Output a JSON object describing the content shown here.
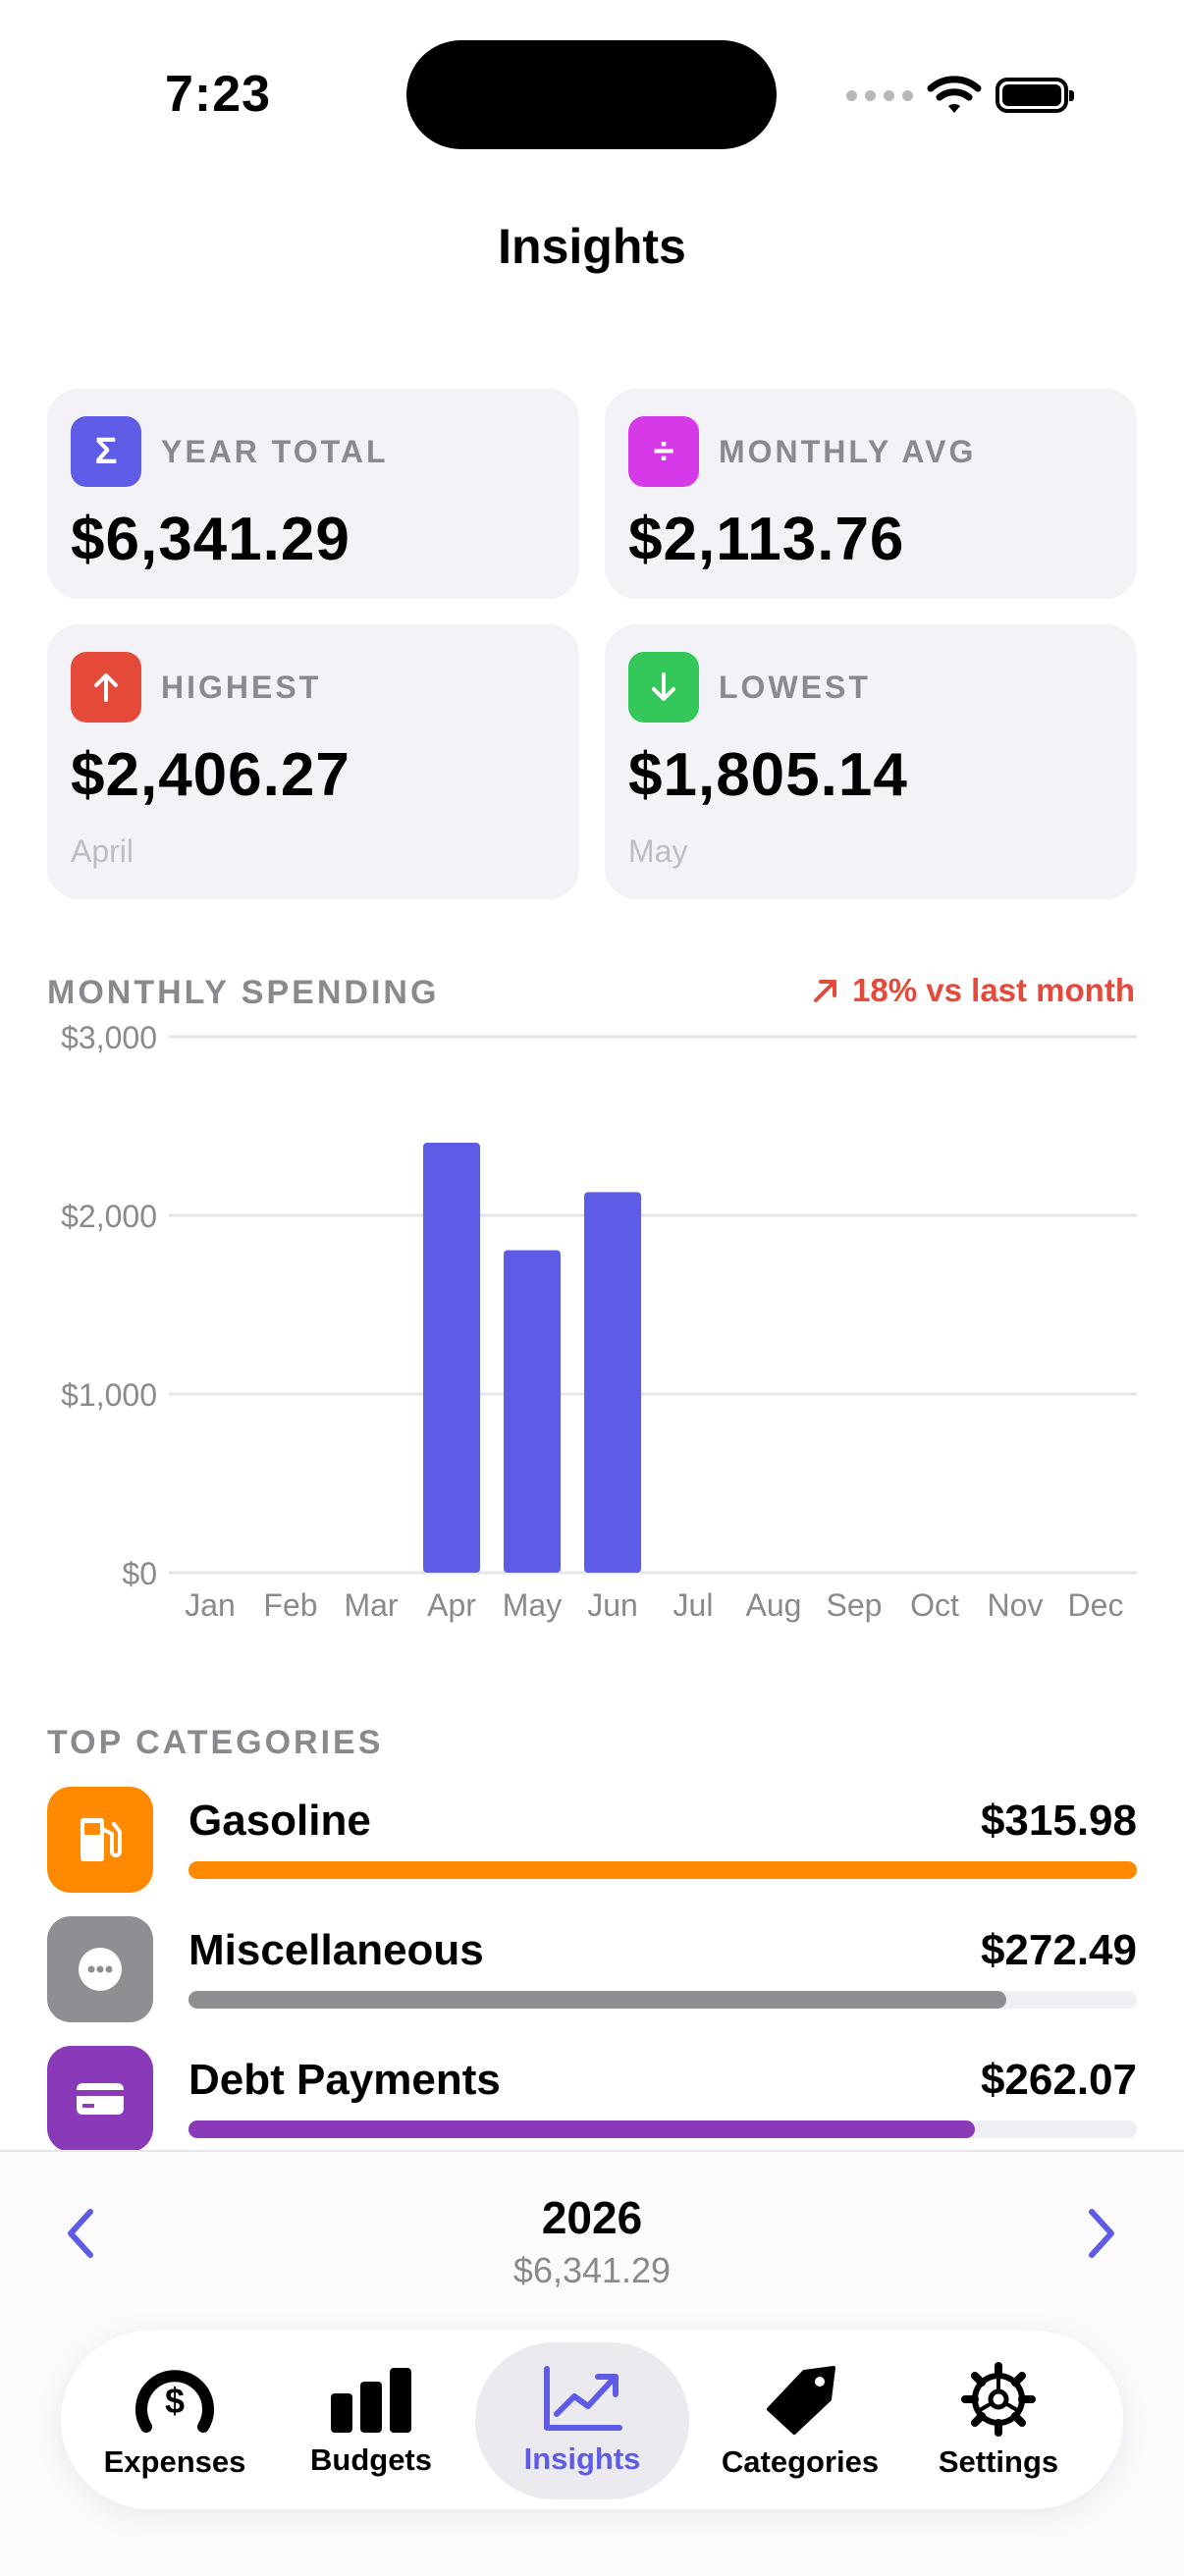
{
  "status": {
    "time": "7:23"
  },
  "nav": {
    "title": "Insights"
  },
  "stats": {
    "year_total": {
      "label": "YEAR TOTAL",
      "value": "$6,341.29",
      "icon": "Σ",
      "color": "#5e5ce6"
    },
    "monthly_avg": {
      "label": "MONTHLY AVG",
      "value": "$2,113.76",
      "icon": "÷",
      "color": "#d63ae8"
    },
    "highest": {
      "label": "HIGHEST",
      "value": "$2,406.27",
      "sub": "April",
      "icon": "arrow-up-icon",
      "color": "#e5493a"
    },
    "lowest": {
      "label": "LOWEST",
      "value": "$1,805.14",
      "sub": "May",
      "icon": "arrow-down-icon",
      "color": "#34c759"
    }
  },
  "spending": {
    "label": "MONTHLY SPENDING",
    "trend": "18% vs last month",
    "trend_color": "#e5493a"
  },
  "chart_data": {
    "type": "bar",
    "categories": [
      "Jan",
      "Feb",
      "Mar",
      "Apr",
      "May",
      "Jun",
      "Jul",
      "Aug",
      "Sep",
      "Oct",
      "Nov",
      "Dec"
    ],
    "values": [
      0,
      0,
      0,
      2406.27,
      1805.14,
      2129.88,
      0,
      0,
      0,
      0,
      0,
      0
    ],
    "ylim": [
      0,
      3000
    ],
    "yticks": [
      0,
      1000,
      2000,
      3000
    ],
    "ytick_labels": [
      "$0",
      "$1,000",
      "$2,000",
      "$3,000"
    ],
    "bar_color": "#5e5ce6",
    "grid": true
  },
  "categories": {
    "label": "TOP CATEGORIES",
    "items": [
      {
        "name": "Gasoline",
        "amount": "$315.98",
        "fraction": 1.0,
        "color": "#ff8a00",
        "icon": "fuel-pump-icon"
      },
      {
        "name": "Miscellaneous",
        "amount": "$272.49",
        "fraction": 0.862,
        "color": "#8e8e93",
        "icon": "ellipsis-icon"
      },
      {
        "name": "Debt Payments",
        "amount": "$262.07",
        "fraction": 0.829,
        "color": "#8a3ab9",
        "icon": "credit-card-icon"
      }
    ]
  },
  "year_selector": {
    "year": "2026",
    "total": "$6,341.29"
  },
  "tabs": [
    {
      "label": "Expenses",
      "icon": "speedometer-dollar-icon",
      "active": false
    },
    {
      "label": "Budgets",
      "icon": "bar-chart-icon",
      "active": false
    },
    {
      "label": "Insights",
      "icon": "line-chart-icon",
      "active": true
    },
    {
      "label": "Categories",
      "icon": "tag-icon",
      "active": false
    },
    {
      "label": "Settings",
      "icon": "gear-icon",
      "active": false
    }
  ]
}
